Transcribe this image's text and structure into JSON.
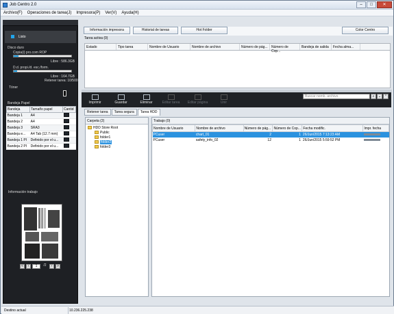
{
  "app": {
    "title": "Job Centro 2.0",
    "controls": {
      "minimize": "–",
      "maximize": "□",
      "close": "✕"
    }
  },
  "menu": [
    "Archivo(F)",
    "Operaciones de tarea(J)",
    "Impresora(P)",
    "Ver(V)",
    "Ayuda(H)"
  ],
  "left": {
    "status": "Listo",
    "disk_title": "Disco duro",
    "copy_label": "Copia(i) pro.com ROP",
    "copy_free": "Libre : 586.3GB",
    "copy_pct": 0.08,
    "dprop_label": "D.d. propi./d. esc./form.",
    "dprop_free": "Libre : 164.7GB",
    "dprop_pct": 0.06,
    "retain": "Retener tarea: 10/500",
    "toner": "Tóner",
    "tray_title": "Bandeja Papel",
    "tray_headers": [
      "Bandeja",
      "Tamaño papel",
      "Cantid"
    ],
    "trays": [
      [
        "Bandeja 1",
        "A4"
      ],
      [
        "Bandeja 2",
        "A4"
      ],
      [
        "Bandeja 3",
        "SRA3"
      ],
      [
        "Bandeja e...",
        "A4 Tab (12.7 mm)"
      ],
      [
        "Bandeja 1 PI",
        "Definido por el u..."
      ],
      [
        "Bandeja 2 PI",
        "Definido por el u..."
      ]
    ],
    "job_info": "Información trabajo",
    "page": "1",
    "pages": "/2"
  },
  "buttons": {
    "info": "Información impresora",
    "history": "Historial de tareas",
    "hot": "Hot Folder",
    "color": "Color Centro"
  },
  "active": {
    "title": "Tarea activa (0)",
    "headers": [
      "Estado",
      "Tipo tarea",
      "Nombre de Usuario",
      "Nombre de archivo",
      "Número de pág...",
      "Número de Cop...",
      "Bandeja de salida",
      "Fecha alma..."
    ]
  },
  "toolbar": {
    "print": "Imprimir",
    "save": "Guardar",
    "delete": "Eliminar",
    "edit": "Editar tarea",
    "edit_page": "Editar página",
    "merge": "Unir",
    "search": "Buscar nomb. archivo"
  },
  "tabs": [
    "Retener tarea",
    "Tarea segura",
    "Tarea HDD"
  ],
  "folders": {
    "title": "Carpeta (2)",
    "root": "HDD Store Root",
    "items": [
      "Public",
      "folder1",
      "folder2",
      "folder3"
    ]
  },
  "jobs": {
    "title": "Trabajo (0)",
    "headers": [
      "Nombre de Usuario",
      "Nombre de archivo",
      "Número de pág...",
      "Número de Cop...",
      "Fecha modific.",
      "Impr. fecha"
    ],
    "rows": [
      [
        "PCuser",
        "chart_01",
        "2",
        "1",
        "26/Jun/2015 7:13:23 AM"
      ],
      [
        "PCuser",
        "safety_info_02",
        "12",
        "1",
        "26/Jun/2015 5:59:52 PM"
      ]
    ]
  },
  "status": {
    "dest": "Destino actual",
    "ip": "10.236.225.238"
  }
}
